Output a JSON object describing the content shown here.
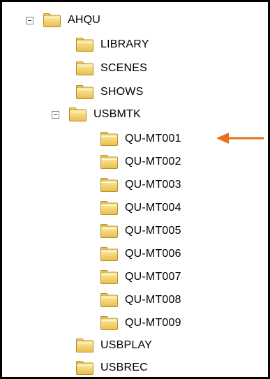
{
  "colors": {
    "folder_fill": "#F2D26A",
    "folder_light": "#FBECA8",
    "folder_stroke": "#B88E26",
    "arrow": "#E8701A",
    "border": "#000000"
  },
  "icons": {
    "expanded_toggle": "minus-box-icon",
    "folder": "folder-icon",
    "pointer": "arrow-left-icon"
  },
  "tree": {
    "root": {
      "label": "AHQU",
      "expanded": true,
      "children": [
        {
          "label": "LIBRARY"
        },
        {
          "label": "SCENES"
        },
        {
          "label": "SHOWS"
        },
        {
          "label": "USBMTK",
          "expanded": true,
          "children": [
            {
              "label": "QU-MT001",
              "pointed": true
            },
            {
              "label": "QU-MT002"
            },
            {
              "label": "QU-MT003"
            },
            {
              "label": "QU-MT004"
            },
            {
              "label": "QU-MT005"
            },
            {
              "label": "QU-MT006"
            },
            {
              "label": "QU-MT007"
            },
            {
              "label": "QU-MT008"
            },
            {
              "label": "QU-MT009"
            }
          ]
        },
        {
          "label": "USBPLAY"
        },
        {
          "label": "USBREC"
        }
      ]
    }
  }
}
